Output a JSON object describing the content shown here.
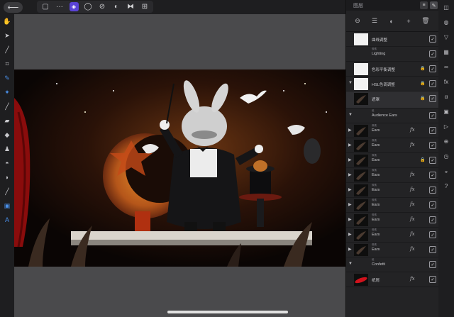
{
  "topbar": {
    "back_icon": "back-arrow-icon",
    "tools": [
      {
        "name": "document-icon",
        "glyph": "▢"
      },
      {
        "name": "more-icon",
        "glyph": "···"
      },
      {
        "name": "persona-icon",
        "glyph": "◈",
        "active": true
      },
      {
        "name": "circle-icon",
        "glyph": "◯"
      },
      {
        "name": "photo-icon",
        "glyph": "⊘"
      },
      {
        "name": "pixel-icon",
        "glyph": "◐"
      },
      {
        "name": "export-icon",
        "glyph": "⧓"
      },
      {
        "name": "tone-icon",
        "glyph": "⊞"
      }
    ]
  },
  "left_tools": [
    {
      "name": "hand-icon",
      "glyph": "✋"
    },
    {
      "name": "move-icon",
      "glyph": "➤"
    },
    {
      "name": "eyedropper-icon",
      "glyph": "╱"
    },
    {
      "name": "crop-icon",
      "glyph": "⌗"
    },
    {
      "name": "selection-brush-icon",
      "glyph": "✎",
      "blue": true
    },
    {
      "name": "flood-select-icon",
      "glyph": "✦",
      "blue": true
    },
    {
      "name": "paint-brush-icon",
      "glyph": "╱"
    },
    {
      "name": "eraser-icon",
      "glyph": "▰"
    },
    {
      "name": "fill-icon",
      "glyph": "◆"
    },
    {
      "name": "clone-icon",
      "glyph": "♟"
    },
    {
      "name": "blur-icon",
      "glyph": "◓"
    },
    {
      "name": "dodge-icon",
      "glyph": "◗"
    },
    {
      "name": "smudge-icon",
      "glyph": "╱"
    },
    {
      "name": "shape-icon",
      "glyph": "▣",
      "blue": true
    },
    {
      "name": "text-icon",
      "glyph": "A",
      "blue": true
    }
  ],
  "panel": {
    "title": "图层",
    "actions": [
      "blend-icon",
      "layers-stack-icon",
      "adjust-icon",
      "add-icon",
      "trash-icon"
    ],
    "layers": [
      {
        "name": "曲线调整",
        "type": "",
        "thumb": "white",
        "check": true,
        "chevron": false,
        "lock": false,
        "fx": false
      },
      {
        "name": "Lighting",
        "type": "像素",
        "thumb": "none",
        "check": true,
        "chevron": false,
        "lock": false,
        "fx": false
      },
      {
        "name": "色彩平衡调整",
        "type": "",
        "thumb": "white",
        "check": true,
        "chevron": false,
        "lock": true,
        "fx": false
      },
      {
        "name": "HSL色调调整",
        "type": "",
        "thumb": "white",
        "check": true,
        "chevron": true,
        "lock": true,
        "fx": false,
        "expanded": true
      },
      {
        "name": "遮罩",
        "type": "",
        "thumb": "dark",
        "check": true,
        "chevron": false,
        "lock": true,
        "fx": false,
        "selected": true,
        "tall": true
      },
      {
        "name": "Audience Ears",
        "type": "组",
        "thumb": "none",
        "check": true,
        "chevron": true,
        "lock": false,
        "fx": false,
        "expanded": true,
        "group": true
      },
      {
        "name": "Ears",
        "type": "像素",
        "thumb": "dark",
        "check": true,
        "chevron": true,
        "lock": false,
        "fx": true
      },
      {
        "name": "Ears",
        "type": "像素",
        "thumb": "dark",
        "check": true,
        "chevron": true,
        "lock": false,
        "fx": true
      },
      {
        "name": "Ears",
        "type": "像素",
        "thumb": "dark",
        "check": true,
        "chevron": true,
        "lock": true,
        "fx": false
      },
      {
        "name": "Ears",
        "type": "像素",
        "thumb": "dark",
        "check": true,
        "chevron": true,
        "lock": false,
        "fx": true
      },
      {
        "name": "Ears",
        "type": "像素",
        "thumb": "dark",
        "check": true,
        "chevron": true,
        "lock": false,
        "fx": true
      },
      {
        "name": "Ears",
        "type": "像素",
        "thumb": "dark",
        "check": true,
        "chevron": true,
        "lock": false,
        "fx": true
      },
      {
        "name": "Ears",
        "type": "像素",
        "thumb": "dark",
        "check": true,
        "chevron": true,
        "lock": false,
        "fx": true
      },
      {
        "name": "Ears",
        "type": "像素",
        "thumb": "dark",
        "check": true,
        "chevron": true,
        "lock": false,
        "fx": true
      },
      {
        "name": "Ears",
        "type": "像素",
        "thumb": "dark",
        "check": true,
        "chevron": true,
        "lock": false,
        "fx": true
      },
      {
        "name": "Confetti",
        "type": "组",
        "thumb": "none",
        "check": true,
        "chevron": true,
        "lock": false,
        "fx": false,
        "expanded": true,
        "group": true
      },
      {
        "name": "纸屑",
        "type": "",
        "thumb": "red",
        "check": true,
        "chevron": false,
        "lock": false,
        "fx": true
      }
    ]
  },
  "right_tools": [
    "layers-icon",
    "brush-panel-icon",
    "color-icon",
    "swatches-icon",
    "stroke-icon",
    "effects-icon",
    "character-icon",
    "styles-icon",
    "navigator-icon",
    "transform-icon",
    "history-icon",
    "channels-icon",
    "help-icon"
  ],
  "colors": {
    "accent": "#5a43d6",
    "selection_blue": "#4a8fe8",
    "canvas_bg": "#4a4a4c",
    "panel_bg": "#232325"
  }
}
